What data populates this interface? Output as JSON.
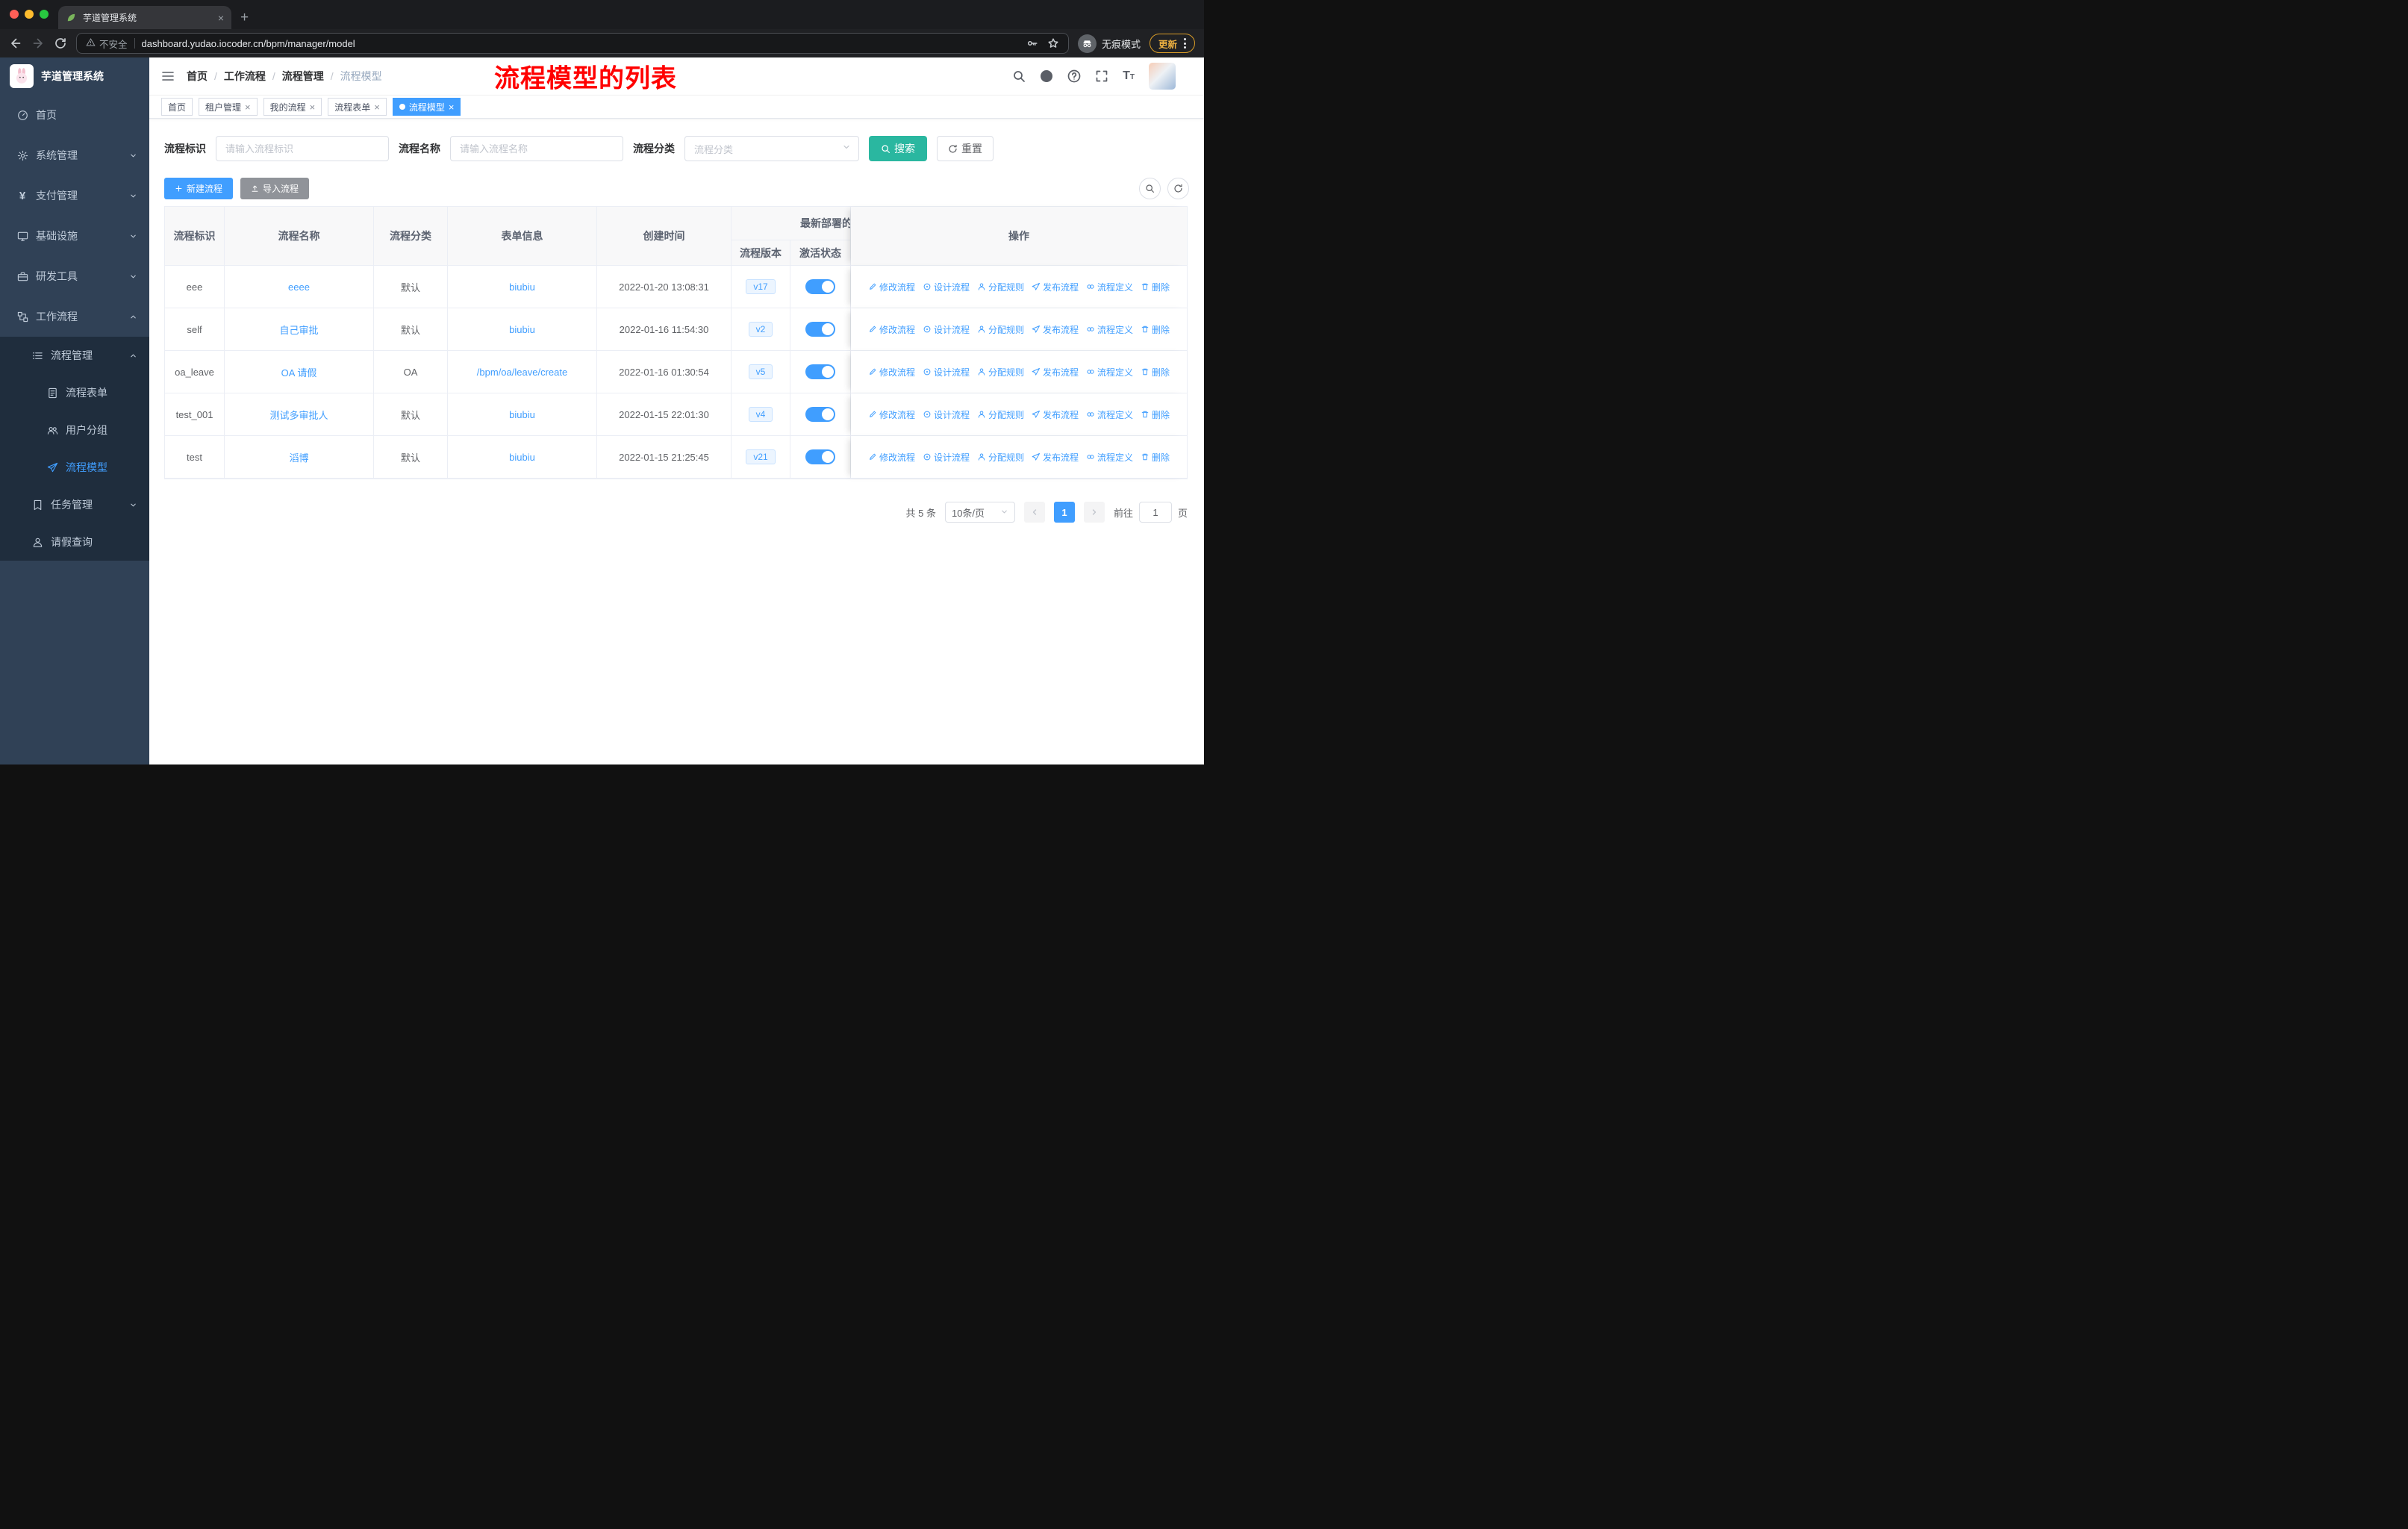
{
  "browser": {
    "tab_title": "芋道管理系统",
    "security_label": "不安全",
    "url": "dashboard.yudao.iocoder.cn/bpm/manager/model",
    "incognito_label": "无痕模式",
    "update_label": "更新"
  },
  "sidebar": {
    "logo_title": "芋道管理系统",
    "items": [
      {
        "label": "首页",
        "icon": "dashboard-icon"
      },
      {
        "label": "系统管理",
        "icon": "gear-icon",
        "expandable": true
      },
      {
        "label": "支付管理",
        "icon": "yen-icon",
        "expandable": true
      },
      {
        "label": "基础设施",
        "icon": "monitor-icon",
        "expandable": true
      },
      {
        "label": "研发工具",
        "icon": "toolbox-icon",
        "expandable": true
      },
      {
        "label": "工作流程",
        "icon": "workflow-icon",
        "expandable": true,
        "expanded": true
      },
      {
        "label": "流程管理",
        "icon": "list-icon",
        "expandable": true,
        "expanded": true
      },
      {
        "label": "流程表单",
        "icon": "form-icon"
      },
      {
        "label": "用户分组",
        "icon": "user-group-icon"
      },
      {
        "label": "流程模型",
        "icon": "paper-plane-icon",
        "active": true
      },
      {
        "label": "任务管理",
        "icon": "task-icon",
        "expandable": true
      },
      {
        "label": "请假查询",
        "icon": "person-icon"
      }
    ]
  },
  "header": {
    "breadcrumb": [
      "首页",
      "工作流程",
      "流程管理",
      "流程模型"
    ],
    "annotation": "流程模型的列表",
    "icons": [
      "search-icon",
      "github-icon",
      "help-icon",
      "fullscreen-icon",
      "font-size-icon",
      "avatar"
    ]
  },
  "tagbar": {
    "tags": [
      {
        "label": "首页",
        "closable": false,
        "active": false
      },
      {
        "label": "租户管理",
        "closable": true,
        "active": false
      },
      {
        "label": "我的流程",
        "closable": true,
        "active": false
      },
      {
        "label": "流程表单",
        "closable": true,
        "active": false
      },
      {
        "label": "流程模型",
        "closable": true,
        "active": true
      }
    ]
  },
  "filters": {
    "id_label": "流程标识",
    "id_placeholder": "请输入流程标识",
    "name_label": "流程名称",
    "name_placeholder": "请输入流程名称",
    "category_label": "流程分类",
    "category_placeholder": "流程分类",
    "search_label": "搜索",
    "reset_label": "重置"
  },
  "toolbar": {
    "create_label": "新建流程",
    "import_label": "导入流程"
  },
  "table": {
    "columns": [
      "流程标识",
      "流程名称",
      "流程分类",
      "表单信息",
      "创建时间"
    ],
    "group_header": "最新部署的",
    "sub_columns": [
      "流程版本",
      "激活状态"
    ],
    "op_header": "操作",
    "op_actions": [
      "修改流程",
      "设计流程",
      "分配规则",
      "发布流程",
      "流程定义",
      "删除"
    ],
    "rows": [
      {
        "id": "eee",
        "name": "eeee",
        "category": "默认",
        "form": "biubiu",
        "created": "2022-01-20 13:08:31",
        "version": "v17",
        "active": true
      },
      {
        "id": "self",
        "name": "自己审批",
        "category": "默认",
        "form": "biubiu",
        "created": "2022-01-16 11:54:30",
        "version": "v2",
        "active": true
      },
      {
        "id": "oa_leave",
        "name": "OA 请假",
        "category": "OA",
        "form": "/bpm/oa/leave/create",
        "created": "2022-01-16 01:30:54",
        "version": "v5",
        "active": true
      },
      {
        "id": "test_001",
        "name": "测试多审批人",
        "category": "默认",
        "form": "biubiu",
        "created": "2022-01-15 22:01:30",
        "version": "v4",
        "active": true
      },
      {
        "id": "test",
        "name": "滔博",
        "category": "默认",
        "form": "biubiu",
        "created": "2022-01-15 21:25:45",
        "version": "v21",
        "active": true
      }
    ]
  },
  "pagination": {
    "total": "共 5 条",
    "page_size": "10条/页",
    "current_page": "1",
    "goto_label": "前往",
    "goto_value": "1",
    "page_unit": "页"
  },
  "colors": {
    "accent": "#409eff",
    "search_button": "#2ab7a0",
    "annotation_red": "#ff0000",
    "sidebar_bg": "#304156",
    "submenu_bg": "#1f2d3d",
    "active_tag": "#409eff"
  }
}
